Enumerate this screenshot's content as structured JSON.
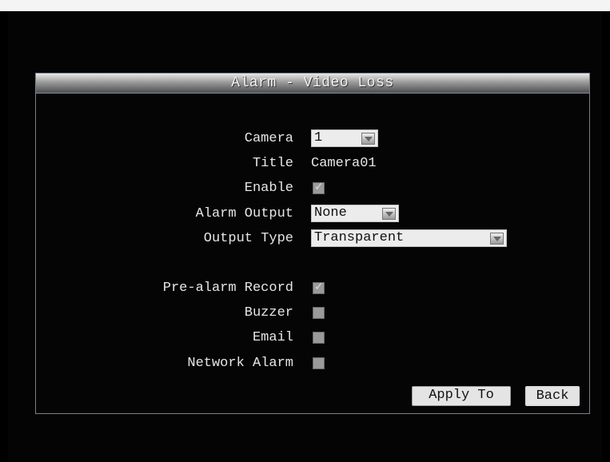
{
  "dialog": {
    "title": "Alarm - Video Loss"
  },
  "fields": {
    "camera": {
      "label": "Camera",
      "value": "1"
    },
    "title": {
      "label": "Title",
      "value": "Camera01"
    },
    "enable": {
      "label": "Enable",
      "checked": true
    },
    "alarm_output": {
      "label": "Alarm Output",
      "value": "None"
    },
    "output_type": {
      "label": "Output Type",
      "value": "Transparent"
    },
    "pre_alarm_record": {
      "label": "Pre-alarm Record",
      "checked": true
    },
    "buzzer": {
      "label": "Buzzer",
      "checked": false
    },
    "email": {
      "label": "Email",
      "checked": false
    },
    "network_alarm": {
      "label": "Network Alarm",
      "checked": false
    }
  },
  "buttons": {
    "apply_to": "Apply To",
    "back": "Back"
  },
  "colors": {
    "background": "#000000",
    "border": "#6f7fa4",
    "text": "#e6e6e6"
  }
}
